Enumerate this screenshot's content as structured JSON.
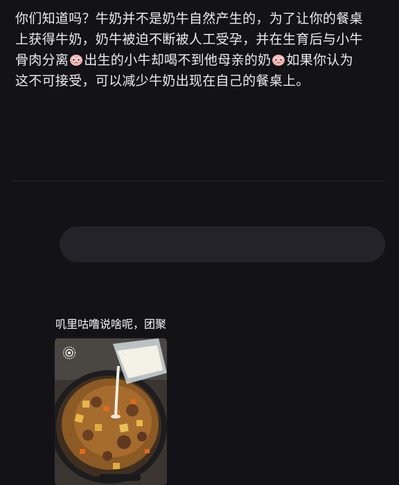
{
  "post": {
    "line1": "你们知道吗？牛奶并不是奶牛自然产生的，为了让你的餐桌",
    "line2": "上获得牛奶，奶牛被迫不断被人工受孕，并在生育后与小牛",
    "line3_a": "骨肉分离",
    "line3_b": "出生的小牛却喝不到他母亲的奶",
    "line3_c": "如果你认为",
    "line4": "这不可接受，可以减少牛奶出现在自己的餐桌上。",
    "emoji_icon": "pleading-face-emoji"
  },
  "comment": {
    "text": "叽里咕噜说啥呢，团聚",
    "photo_badge_icon": "live-photo-icon"
  },
  "colors": {
    "background": "#131217",
    "text": "#ecebf0",
    "input_bg": "#24232a"
  }
}
